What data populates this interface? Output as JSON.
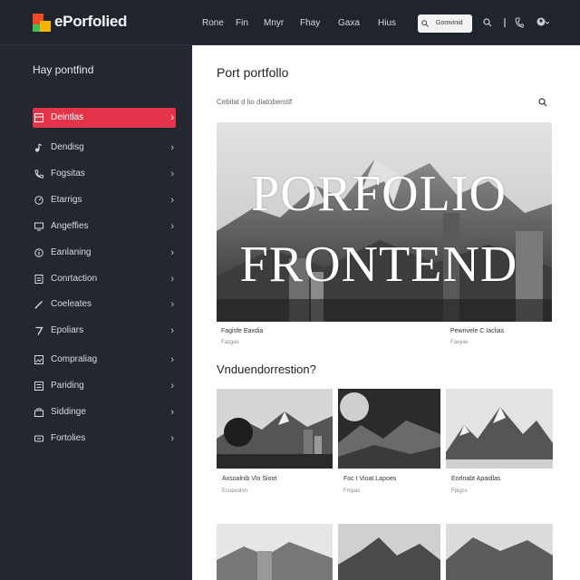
{
  "app": {
    "brand": "ePorfolied",
    "brand_colors": [
      "#f04a2a",
      "#f7b500",
      "#3fbf4f"
    ]
  },
  "topnav": {
    "items": [
      "Rone",
      "Fin",
      "Mnyr",
      "Fhay",
      "Gaxa",
      "Hius"
    ],
    "search_label": "Gomvinid",
    "icons": [
      "search-icon",
      "bell-icon",
      "user-icon"
    ]
  },
  "sidebar": {
    "title": "Hay pontfind",
    "items": [
      {
        "label": "Deintlas",
        "icon": "layout-icon",
        "active": true
      },
      {
        "label": "Dendisg",
        "icon": "music-icon",
        "active": false
      },
      {
        "label": "Fogsitas",
        "icon": "phone-icon",
        "active": false
      },
      {
        "label": "Etarrigs",
        "icon": "clock-icon",
        "active": false
      },
      {
        "label": "Angeffies",
        "icon": "monitor-icon",
        "active": false
      },
      {
        "label": "Eanlaning",
        "icon": "info-icon",
        "active": false
      },
      {
        "label": "Conrtaction",
        "icon": "document-icon",
        "active": false
      },
      {
        "label": "Coeleates",
        "icon": "pen-icon",
        "active": false
      },
      {
        "label": "Epoliars",
        "icon": "seven-icon",
        "active": false
      },
      {
        "label": "Compraliag",
        "icon": "image-icon",
        "active": false
      },
      {
        "label": "Pariding",
        "icon": "list-icon",
        "active": false
      },
      {
        "label": "Siddinge",
        "icon": "bag-icon",
        "active": false
      },
      {
        "label": "Fortolies",
        "icon": "card-icon",
        "active": false
      }
    ]
  },
  "main": {
    "title": "Port portfollo",
    "filter_text": "Cebilat d lio diatoberstif",
    "overlay_lines": [
      "PORFOLIO",
      "FRONTEND"
    ],
    "hero": {
      "left_caption": "Fagisfe Eaxdia",
      "left_sub": "Fazgas",
      "right_caption": "Pewnvele C Iaclias",
      "right_sub": "Fauyas"
    },
    "section_title": "Vnduendorrestion?",
    "cards": [
      {
        "caption": "Axsoalnib Vlo Sioot",
        "sub": "Ecopxolnn"
      },
      {
        "caption": "Foc t Vioat Lapoes",
        "sub": "Fmpas"
      },
      {
        "caption": "Eorlnabt Apaidlas",
        "sub": "Fpigcs"
      }
    ]
  }
}
